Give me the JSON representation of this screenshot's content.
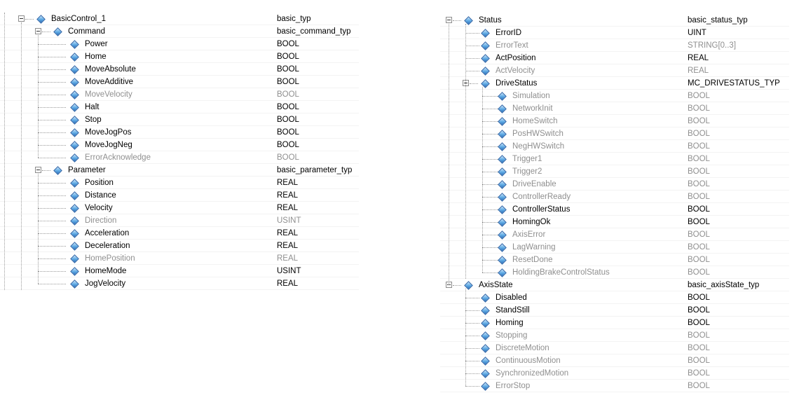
{
  "left_tree": {
    "root": {
      "name": "BasicControl_1",
      "type": "basic_typ"
    },
    "command": {
      "name": "Command",
      "type": "basic_command_typ",
      "items": [
        {
          "name": "Power",
          "type": "BOOL"
        },
        {
          "name": "Home",
          "type": "BOOL"
        },
        {
          "name": "MoveAbsolute",
          "type": "BOOL"
        },
        {
          "name": "MoveAdditive",
          "type": "BOOL"
        },
        {
          "name": "MoveVelocity",
          "type": "BOOL",
          "disabled": true
        },
        {
          "name": "Halt",
          "type": "BOOL"
        },
        {
          "name": "Stop",
          "type": "BOOL"
        },
        {
          "name": "MoveJogPos",
          "type": "BOOL"
        },
        {
          "name": "MoveJogNeg",
          "type": "BOOL"
        },
        {
          "name": "ErrorAcknowledge",
          "type": "BOOL",
          "disabled": true
        }
      ]
    },
    "parameter": {
      "name": "Parameter",
      "type": "basic_parameter_typ",
      "items": [
        {
          "name": "Position",
          "type": "REAL"
        },
        {
          "name": "Distance",
          "type": "REAL"
        },
        {
          "name": "Velocity",
          "type": "REAL"
        },
        {
          "name": "Direction",
          "type": "USINT",
          "disabled": true
        },
        {
          "name": "Acceleration",
          "type": "REAL"
        },
        {
          "name": "Deceleration",
          "type": "REAL"
        },
        {
          "name": "HomePosition",
          "type": "REAL",
          "disabled": true
        },
        {
          "name": "HomeMode",
          "type": "USINT"
        },
        {
          "name": "JogVelocity",
          "type": "REAL"
        }
      ]
    }
  },
  "right_tree": {
    "status": {
      "name": "Status",
      "type": "basic_status_typ",
      "items_before": [
        {
          "name": "ErrorID",
          "type": "UINT"
        },
        {
          "name": "ErrorText",
          "type": "STRING[0..3]",
          "disabled": true
        },
        {
          "name": "ActPosition",
          "type": "REAL"
        },
        {
          "name": "ActVelocity",
          "type": "REAL",
          "disabled": true
        }
      ],
      "drive_status": {
        "name": "DriveStatus",
        "type": "MC_DRIVESTATUS_TYP",
        "items": [
          {
            "name": "Simulation",
            "type": "BOOL",
            "disabled": true
          },
          {
            "name": "NetworkInit",
            "type": "BOOL",
            "disabled": true
          },
          {
            "name": "HomeSwitch",
            "type": "BOOL",
            "disabled": true
          },
          {
            "name": "PosHWSwitch",
            "type": "BOOL",
            "disabled": true
          },
          {
            "name": "NegHWSwitch",
            "type": "BOOL",
            "disabled": true
          },
          {
            "name": "Trigger1",
            "type": "BOOL",
            "disabled": true
          },
          {
            "name": "Trigger2",
            "type": "BOOL",
            "disabled": true
          },
          {
            "name": "DriveEnable",
            "type": "BOOL",
            "disabled": true
          },
          {
            "name": "ControllerReady",
            "type": "BOOL",
            "disabled": true
          },
          {
            "name": "ControllerStatus",
            "type": "BOOL"
          },
          {
            "name": "HomingOk",
            "type": "BOOL"
          },
          {
            "name": "AxisError",
            "type": "BOOL",
            "disabled": true
          },
          {
            "name": "LagWarning",
            "type": "BOOL",
            "disabled": true
          },
          {
            "name": "ResetDone",
            "type": "BOOL",
            "disabled": true
          },
          {
            "name": "HoldingBrakeControlStatus",
            "type": "BOOL",
            "disabled": true
          }
        ]
      }
    },
    "axis_state": {
      "name": "AxisState",
      "type": "basic_axisState_typ",
      "items": [
        {
          "name": "Disabled",
          "type": "BOOL"
        },
        {
          "name": "StandStill",
          "type": "BOOL"
        },
        {
          "name": "Homing",
          "type": "BOOL"
        },
        {
          "name": "Stopping",
          "type": "BOOL",
          "disabled": true
        },
        {
          "name": "DiscreteMotion",
          "type": "BOOL",
          "disabled": true
        },
        {
          "name": "ContinuousMotion",
          "type": "BOOL",
          "disabled": true
        },
        {
          "name": "SynchronizedMotion",
          "type": "BOOL",
          "disabled": true
        },
        {
          "name": "ErrorStop",
          "type": "BOOL",
          "disabled": true
        }
      ]
    }
  }
}
